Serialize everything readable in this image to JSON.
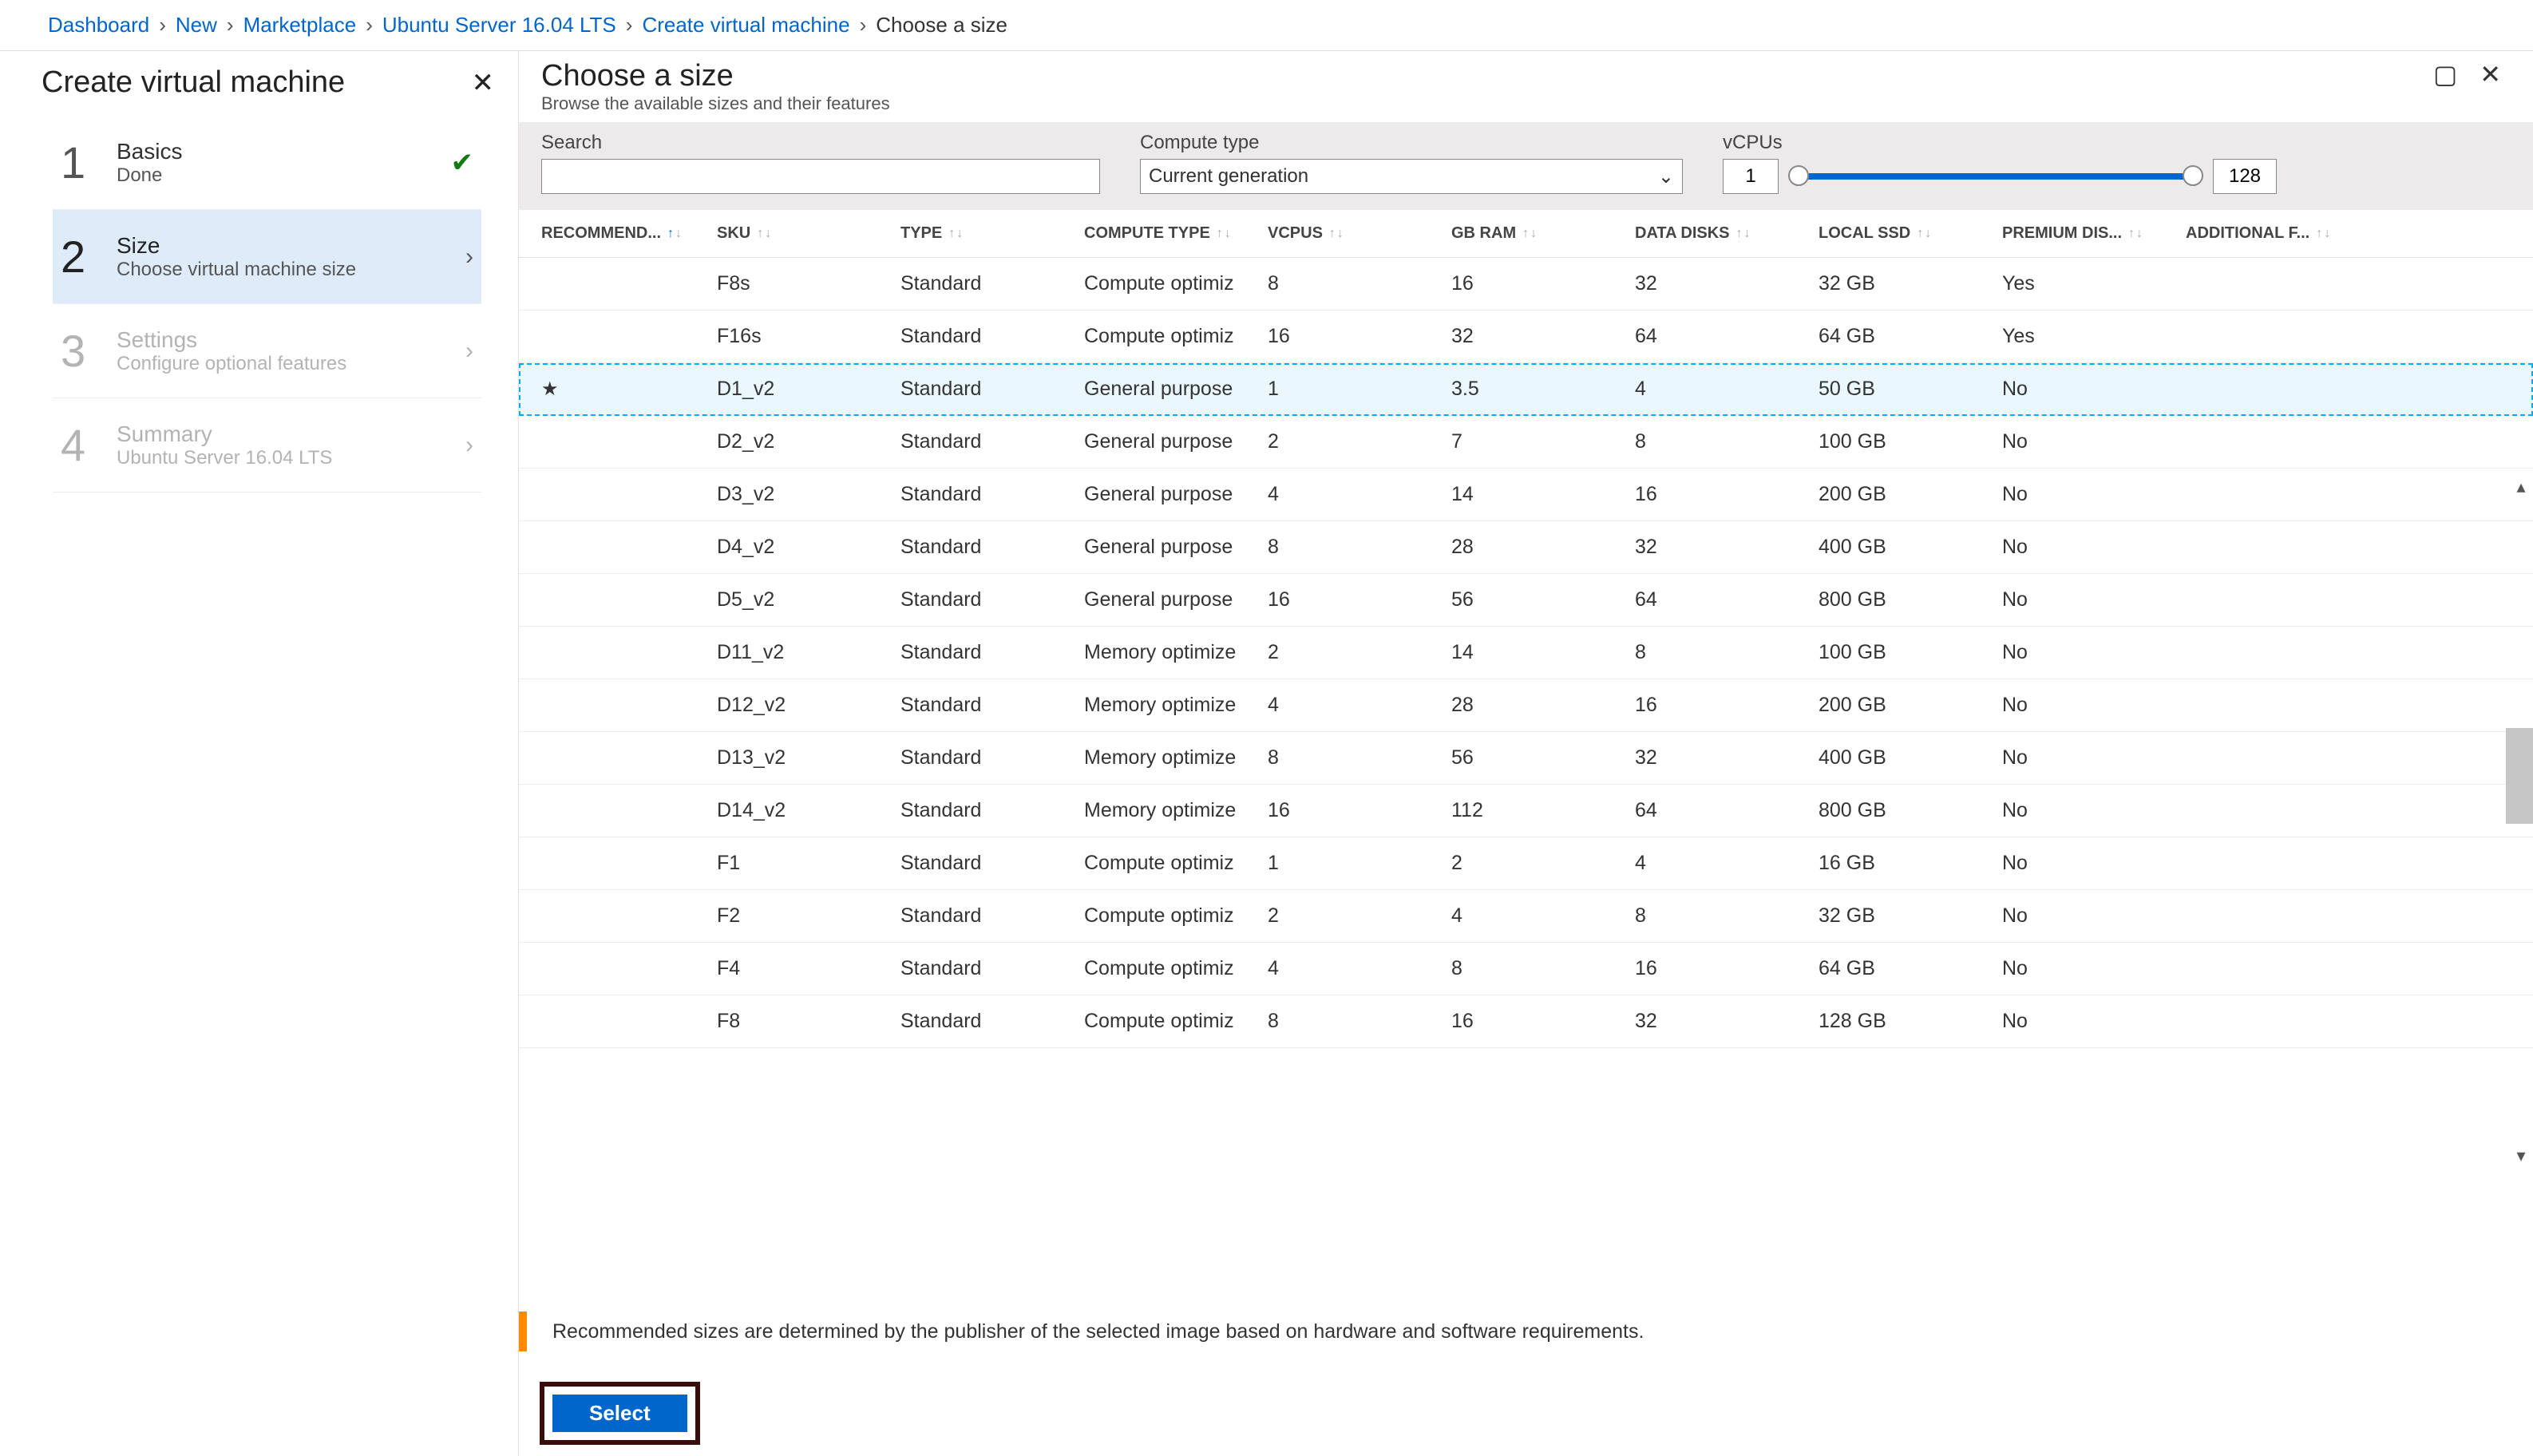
{
  "breadcrumbs": {
    "items": [
      "Dashboard",
      "New",
      "Marketplace",
      "Ubuntu Server 16.04 LTS",
      "Create virtual machine"
    ],
    "current": "Choose a size"
  },
  "leftBlade": {
    "title": "Create virtual machine",
    "steps": [
      {
        "num": "1",
        "title": "Basics",
        "sub": "Done",
        "state": "done"
      },
      {
        "num": "2",
        "title": "Size",
        "sub": "Choose virtual machine size",
        "state": "active"
      },
      {
        "num": "3",
        "title": "Settings",
        "sub": "Configure optional features",
        "state": "disabled"
      },
      {
        "num": "4",
        "title": "Summary",
        "sub": "Ubuntu Server 16.04 LTS",
        "state": "disabled"
      }
    ]
  },
  "rightBlade": {
    "title": "Choose a size",
    "subtitle": "Browse the available sizes and their features",
    "filters": {
      "search_label": "Search",
      "compute_label": "Compute type",
      "compute_value": "Current generation",
      "vcpu_label": "vCPUs",
      "vcpu_min": "1",
      "vcpu_max": "128"
    }
  },
  "table": {
    "headers": {
      "rec": "RECOMMEND...",
      "sku": "SKU",
      "type": "TYPE",
      "compute": "COMPUTE TYPE",
      "vcpus": "VCPUS",
      "gbram": "GB RAM",
      "disks": "DATA DISKS",
      "ssd": "LOCAL SSD",
      "premium": "PREMIUM DIS...",
      "addl": "ADDITIONAL F..."
    },
    "rows": [
      {
        "rec": "",
        "sku": "F8s",
        "type": "Standard",
        "ct": "Compute optimiz",
        "vc": "8",
        "gb": "16",
        "dd": "32",
        "ls": "32 GB",
        "pd": "Yes",
        "sel": false
      },
      {
        "rec": "",
        "sku": "F16s",
        "type": "Standard",
        "ct": "Compute optimiz",
        "vc": "16",
        "gb": "32",
        "dd": "64",
        "ls": "64 GB",
        "pd": "Yes",
        "sel": false
      },
      {
        "rec": "★",
        "sku": "D1_v2",
        "type": "Standard",
        "ct": "General purpose",
        "vc": "1",
        "gb": "3.5",
        "dd": "4",
        "ls": "50 GB",
        "pd": "No",
        "sel": true
      },
      {
        "rec": "",
        "sku": "D2_v2",
        "type": "Standard",
        "ct": "General purpose",
        "vc": "2",
        "gb": "7",
        "dd": "8",
        "ls": "100 GB",
        "pd": "No",
        "sel": false
      },
      {
        "rec": "",
        "sku": "D3_v2",
        "type": "Standard",
        "ct": "General purpose",
        "vc": "4",
        "gb": "14",
        "dd": "16",
        "ls": "200 GB",
        "pd": "No",
        "sel": false
      },
      {
        "rec": "",
        "sku": "D4_v2",
        "type": "Standard",
        "ct": "General purpose",
        "vc": "8",
        "gb": "28",
        "dd": "32",
        "ls": "400 GB",
        "pd": "No",
        "sel": false
      },
      {
        "rec": "",
        "sku": "D5_v2",
        "type": "Standard",
        "ct": "General purpose",
        "vc": "16",
        "gb": "56",
        "dd": "64",
        "ls": "800 GB",
        "pd": "No",
        "sel": false
      },
      {
        "rec": "",
        "sku": "D11_v2",
        "type": "Standard",
        "ct": "Memory optimize",
        "vc": "2",
        "gb": "14",
        "dd": "8",
        "ls": "100 GB",
        "pd": "No",
        "sel": false
      },
      {
        "rec": "",
        "sku": "D12_v2",
        "type": "Standard",
        "ct": "Memory optimize",
        "vc": "4",
        "gb": "28",
        "dd": "16",
        "ls": "200 GB",
        "pd": "No",
        "sel": false
      },
      {
        "rec": "",
        "sku": "D13_v2",
        "type": "Standard",
        "ct": "Memory optimize",
        "vc": "8",
        "gb": "56",
        "dd": "32",
        "ls": "400 GB",
        "pd": "No",
        "sel": false
      },
      {
        "rec": "",
        "sku": "D14_v2",
        "type": "Standard",
        "ct": "Memory optimize",
        "vc": "16",
        "gb": "112",
        "dd": "64",
        "ls": "800 GB",
        "pd": "No",
        "sel": false
      },
      {
        "rec": "",
        "sku": "F1",
        "type": "Standard",
        "ct": "Compute optimiz",
        "vc": "1",
        "gb": "2",
        "dd": "4",
        "ls": "16 GB",
        "pd": "No",
        "sel": false
      },
      {
        "rec": "",
        "sku": "F2",
        "type": "Standard",
        "ct": "Compute optimiz",
        "vc": "2",
        "gb": "4",
        "dd": "8",
        "ls": "32 GB",
        "pd": "No",
        "sel": false
      },
      {
        "rec": "",
        "sku": "F4",
        "type": "Standard",
        "ct": "Compute optimiz",
        "vc": "4",
        "gb": "8",
        "dd": "16",
        "ls": "64 GB",
        "pd": "No",
        "sel": false
      },
      {
        "rec": "",
        "sku": "F8",
        "type": "Standard",
        "ct": "Compute optimiz",
        "vc": "8",
        "gb": "16",
        "dd": "32",
        "ls": "128 GB",
        "pd": "No",
        "sel": false
      }
    ]
  },
  "info_text": "Recommended sizes are determined by the publisher of the selected image based on hardware and software requirements.",
  "select_button": "Select"
}
